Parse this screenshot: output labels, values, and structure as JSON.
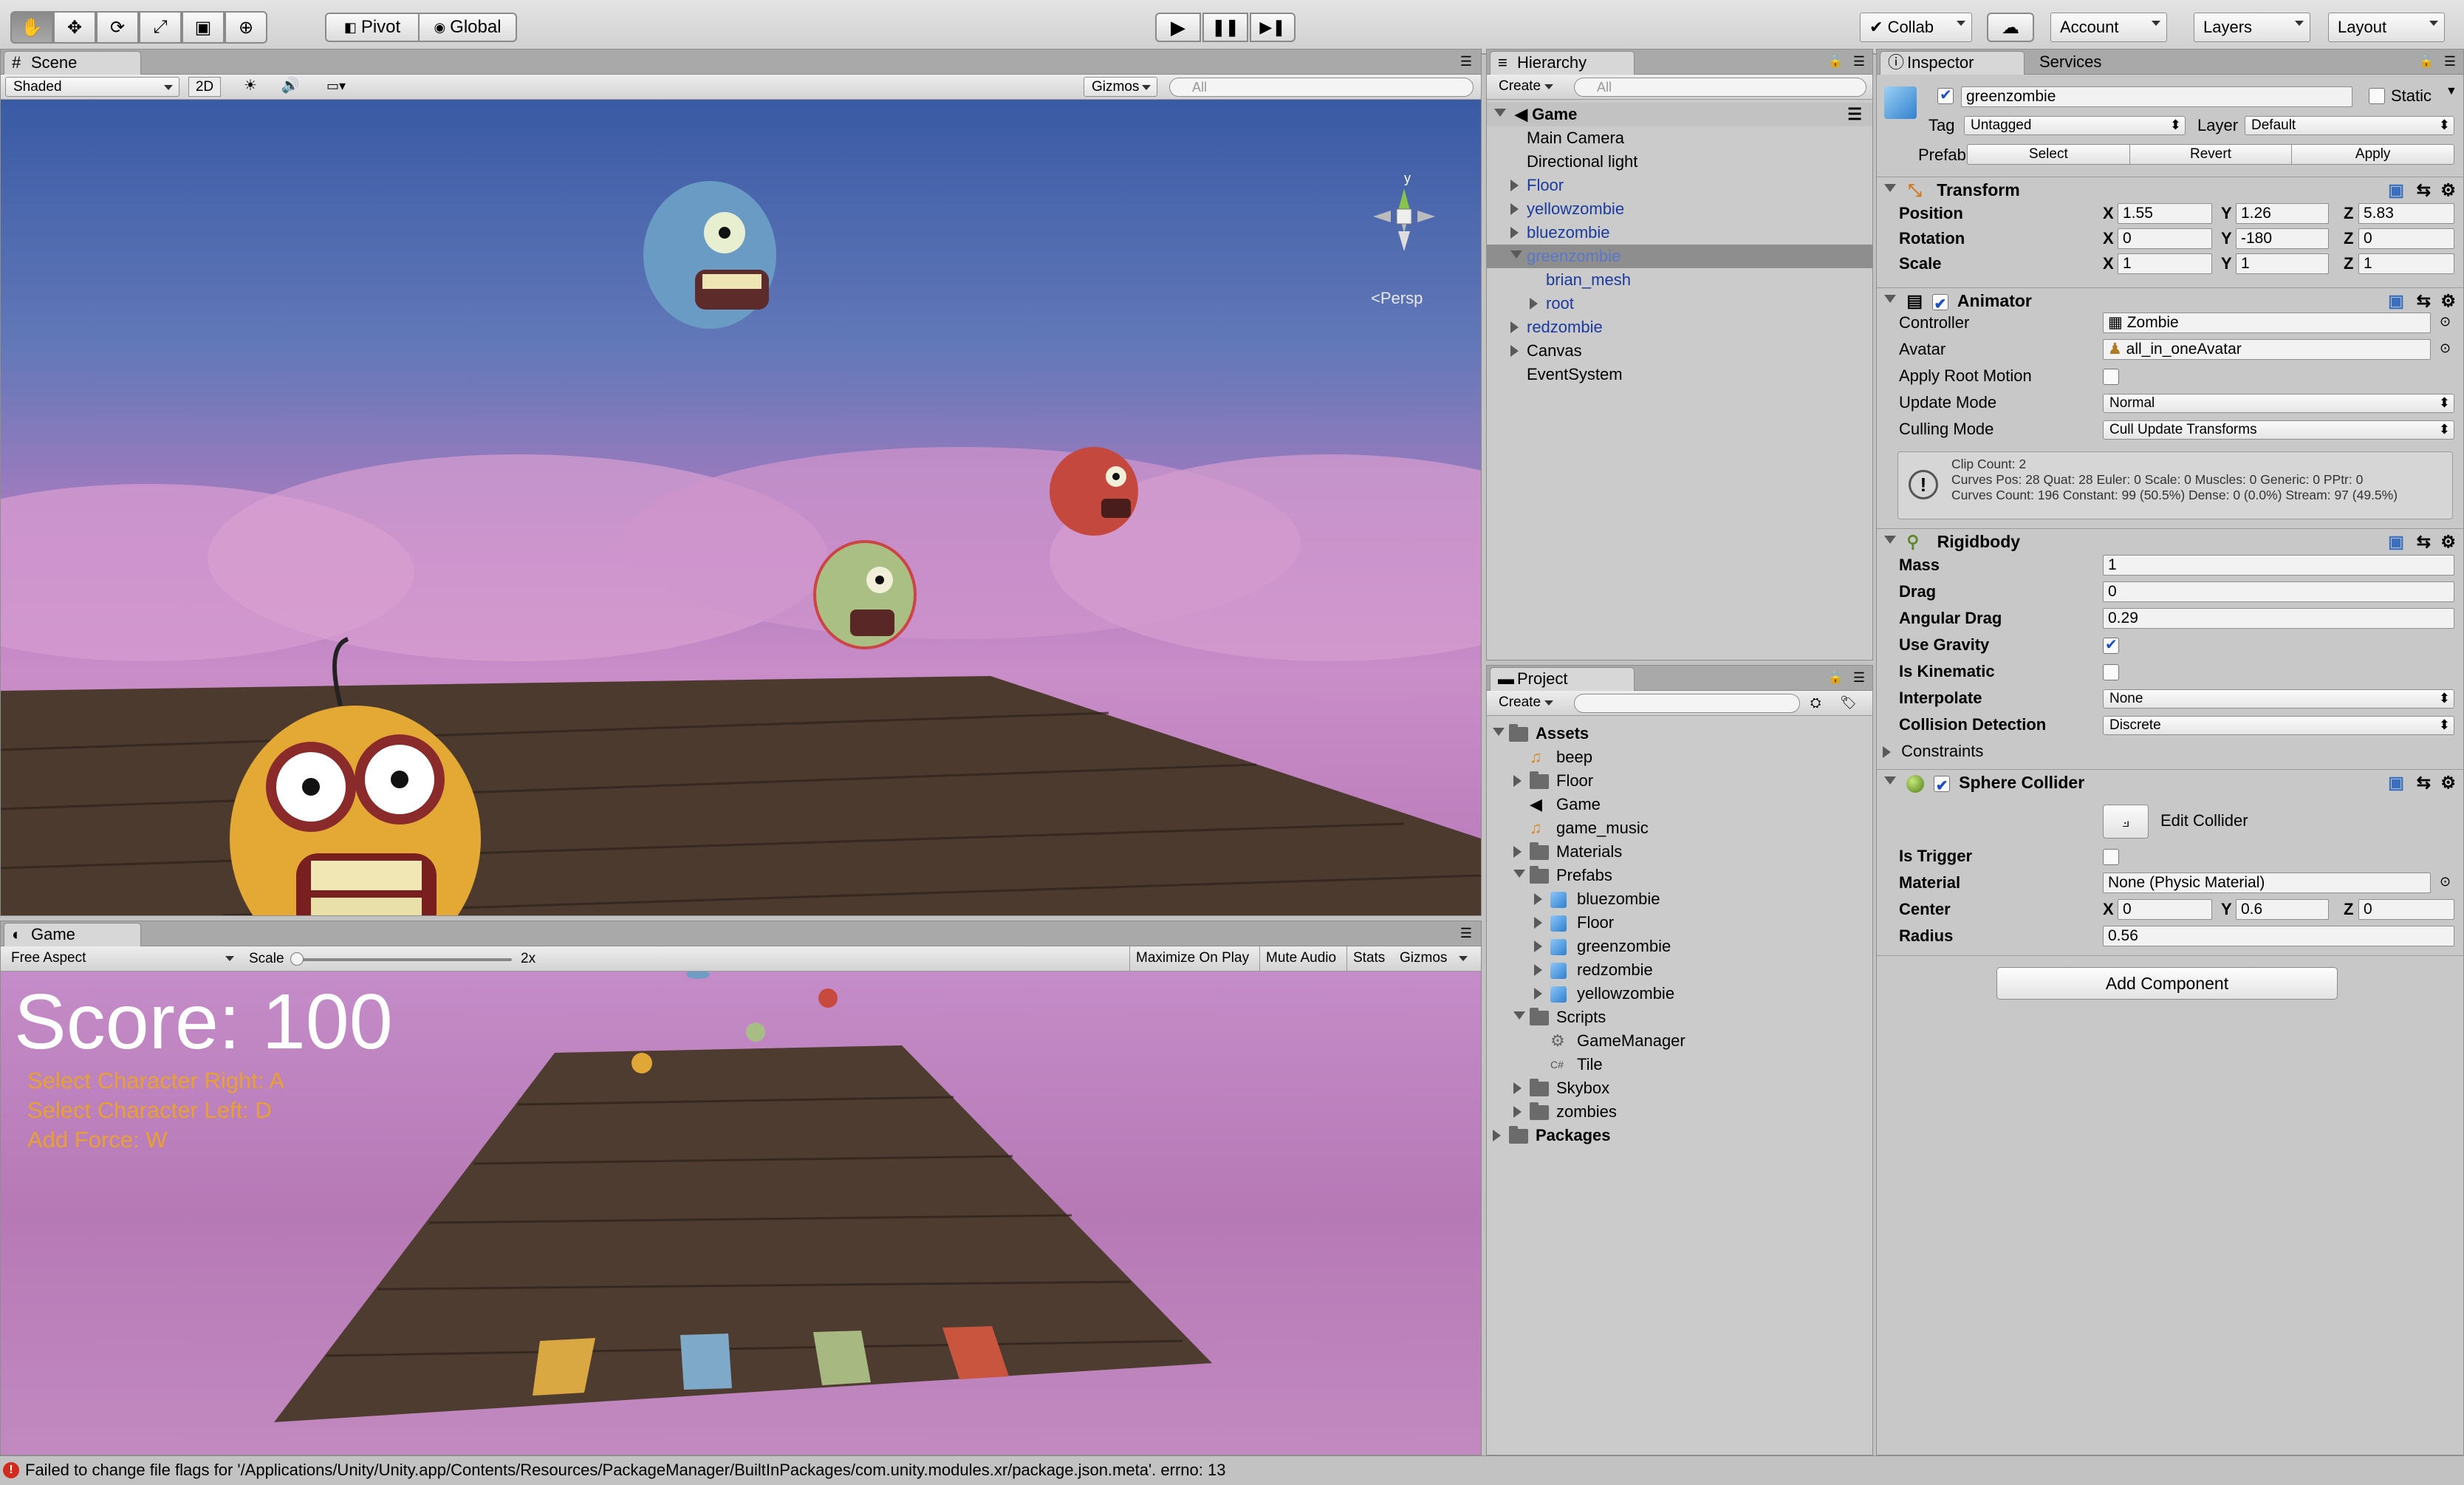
{
  "toolbar": {
    "tools": [
      "hand-tool-icon",
      "move-tool-icon",
      "rotate-tool-icon",
      "scale-tool-icon",
      "rect-tool-icon",
      "transform-tool-icon"
    ],
    "pivot": "Pivot",
    "global": "Global",
    "collab": "Collab",
    "account": "Account",
    "layers": "Layers",
    "layout": "Layout"
  },
  "scene": {
    "tab": "Scene",
    "shading": "Shaded",
    "mode2d": "2D",
    "gizmos": "Gizmos",
    "search_placeholder": "All",
    "persp": "Persp",
    "axis_y": "y"
  },
  "game": {
    "tab": "Game",
    "aspect": "Free Aspect",
    "scale_label": "Scale",
    "scale_value": "2x",
    "maximize": "Maximize On Play",
    "mute": "Mute Audio",
    "stats": "Stats",
    "gizmos": "Gizmos",
    "score": "Score: 100",
    "instructions": [
      "Select Character Right: A",
      "Select Character Left: D",
      "Add Force: W"
    ]
  },
  "hierarchy": {
    "tab": "Hierarchy",
    "create": "Create",
    "search_placeholder": "All",
    "root": "Game",
    "items": [
      {
        "label": "Main Camera",
        "depth": 1,
        "arrow": "",
        "prefab": false
      },
      {
        "label": "Directional light",
        "depth": 1,
        "arrow": "",
        "prefab": false
      },
      {
        "label": "Floor",
        "depth": 1,
        "arrow": "right",
        "prefab": true
      },
      {
        "label": "yellowzombie",
        "depth": 1,
        "arrow": "right",
        "prefab": true
      },
      {
        "label": "bluezombie",
        "depth": 1,
        "arrow": "right",
        "prefab": true
      },
      {
        "label": "greenzombie",
        "depth": 1,
        "arrow": "down",
        "prefab": true,
        "selected": true
      },
      {
        "label": "brian_mesh",
        "depth": 2,
        "arrow": "",
        "prefab": true
      },
      {
        "label": "root",
        "depth": 2,
        "arrow": "right",
        "prefab": true
      },
      {
        "label": "redzombie",
        "depth": 1,
        "arrow": "right",
        "prefab": true
      },
      {
        "label": "Canvas",
        "depth": 1,
        "arrow": "right",
        "prefab": false
      },
      {
        "label": "EventSystem",
        "depth": 1,
        "arrow": "",
        "prefab": false
      }
    ]
  },
  "project": {
    "tab": "Project",
    "create": "Create",
    "items": [
      {
        "label": "Assets",
        "depth": 0,
        "arrow": "down",
        "icon": "folder",
        "bold": true
      },
      {
        "label": "beep",
        "depth": 1,
        "arrow": "",
        "icon": "audio"
      },
      {
        "label": "Floor",
        "depth": 1,
        "arrow": "right",
        "icon": "folder"
      },
      {
        "label": "Game",
        "depth": 1,
        "arrow": "",
        "icon": "unity"
      },
      {
        "label": "game_music",
        "depth": 1,
        "arrow": "",
        "icon": "audio"
      },
      {
        "label": "Materials",
        "depth": 1,
        "arrow": "right",
        "icon": "folder"
      },
      {
        "label": "Prefabs",
        "depth": 1,
        "arrow": "down",
        "icon": "folder"
      },
      {
        "label": "bluezombie",
        "depth": 2,
        "arrow": "right",
        "icon": "prefab"
      },
      {
        "label": "Floor",
        "depth": 2,
        "arrow": "right",
        "icon": "prefab"
      },
      {
        "label": "greenzombie",
        "depth": 2,
        "arrow": "right",
        "icon": "prefab"
      },
      {
        "label": "redzombie",
        "depth": 2,
        "arrow": "right",
        "icon": "prefab"
      },
      {
        "label": "yellowzombie",
        "depth": 2,
        "arrow": "right",
        "icon": "prefab"
      },
      {
        "label": "Scripts",
        "depth": 1,
        "arrow": "down",
        "icon": "folder"
      },
      {
        "label": "GameManager",
        "depth": 2,
        "arrow": "",
        "icon": "gear"
      },
      {
        "label": "Tile",
        "depth": 2,
        "arrow": "",
        "icon": "script"
      },
      {
        "label": "Skybox",
        "depth": 1,
        "arrow": "right",
        "icon": "folder"
      },
      {
        "label": "zombies",
        "depth": 1,
        "arrow": "right",
        "icon": "folder"
      },
      {
        "label": "Packages",
        "depth": 0,
        "arrow": "right",
        "icon": "folder",
        "bold": true
      }
    ]
  },
  "inspector": {
    "tab": "Inspector",
    "services": "Services",
    "name": "greenzombie",
    "static": "Static",
    "tag_label": "Tag",
    "tag": "Untagged",
    "layer_label": "Layer",
    "layer": "Default",
    "prefab_label": "Prefab",
    "select": "Select",
    "revert": "Revert",
    "apply": "Apply",
    "transform": {
      "title": "Transform",
      "rows": [
        {
          "label": "Position",
          "x": "1.55",
          "y": "1.26",
          "z": "5.83"
        },
        {
          "label": "Rotation",
          "x": "0",
          "y": "-180",
          "z": "0"
        },
        {
          "label": "Scale",
          "x": "1",
          "y": "1",
          "z": "1"
        }
      ]
    },
    "animator": {
      "title": "Animator",
      "controller_label": "Controller",
      "controller": "Zombie",
      "avatar_label": "Avatar",
      "avatar": "all_in_oneAvatar",
      "root_motion_label": "Apply Root Motion",
      "update_label": "Update Mode",
      "update": "Normal",
      "culling_label": "Culling Mode",
      "culling": "Cull Update Transforms",
      "info": [
        "Clip Count: 2",
        "Curves Pos: 28 Quat: 28 Euler: 0 Scale: 0 Muscles: 0 Generic: 0 PPtr: 0",
        "Curves Count: 196 Constant: 99 (50.5%) Dense: 0 (0.0%) Stream: 97 (49.5%)"
      ]
    },
    "rigidbody": {
      "title": "Rigidbody",
      "mass_label": "Mass",
      "mass": "1",
      "drag_label": "Drag",
      "drag": "0",
      "angular_label": "Angular Drag",
      "angular": "0.29",
      "gravity_label": "Use Gravity",
      "kinematic_label": "Is Kinematic",
      "interp_label": "Interpolate",
      "interp": "None",
      "collision_label": "Collision Detection",
      "collision": "Discrete",
      "constraints": "Constraints"
    },
    "sphere": {
      "title": "Sphere Collider",
      "edit": "Edit Collider",
      "trigger_label": "Is Trigger",
      "material_label": "Material",
      "material": "None (Physic Material)",
      "center_label": "Center",
      "cx": "0",
      "cy": "0.6",
      "cz": "0",
      "radius_label": "Radius",
      "radius": "0.56"
    },
    "add_component": "Add Component"
  },
  "status": {
    "message": "Failed to change file flags for '/Applications/Unity/Unity.app/Contents/Resources/PackageManager/BuiltInPackages/com.unity.modules.xr/package.json.meta'. errno: 13"
  },
  "colors": {
    "sky_top": "#3b5fa8",
    "sky_bottom": "#c87fc0",
    "floor": "#4a3a30",
    "score": "#ffffff",
    "instructions": "#e8a030"
  }
}
